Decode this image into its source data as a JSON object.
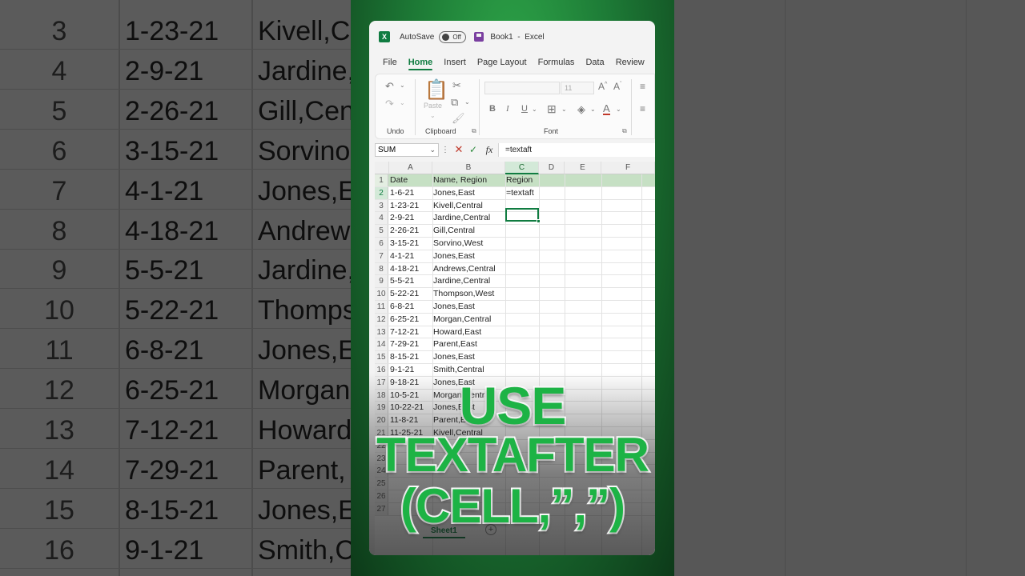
{
  "app": {
    "autosave_label": "AutoSave",
    "autosave_state": "Off",
    "workbook": "Book1",
    "separator": "-",
    "app_name": "Excel",
    "logo_letter": "X",
    "accent_color": "#107c41"
  },
  "tabs": [
    "File",
    "Home",
    "Insert",
    "Page Layout",
    "Formulas",
    "Data",
    "Review"
  ],
  "active_tab": "Home",
  "ribbon": {
    "undo_group": "Undo",
    "clipboard_group": "Clipboard",
    "paste_label": "Paste",
    "font_group": "Font",
    "font_size": "11",
    "bold": "B",
    "italic": "I",
    "underline": "U"
  },
  "formula_bar": {
    "name_box": "SUM",
    "fx_label": "fx",
    "formula": "=textaft"
  },
  "columns": [
    "A",
    "B",
    "C",
    "D",
    "E",
    "F"
  ],
  "rows": [
    {
      "n": "1",
      "a": "Date",
      "b": "Name, Region",
      "c": "Region"
    },
    {
      "n": "2",
      "a": "1-6-21",
      "b": "Jones,East",
      "c": "=textaft"
    },
    {
      "n": "3",
      "a": "1-23-21",
      "b": "Kivell,Central",
      "c": ""
    },
    {
      "n": "4",
      "a": "2-9-21",
      "b": "Jardine,Central",
      "c": ""
    },
    {
      "n": "5",
      "a": "2-26-21",
      "b": "Gill,Central",
      "c": ""
    },
    {
      "n": "6",
      "a": "3-15-21",
      "b": "Sorvino,West",
      "c": ""
    },
    {
      "n": "7",
      "a": "4-1-21",
      "b": "Jones,East",
      "c": ""
    },
    {
      "n": "8",
      "a": "4-18-21",
      "b": "Andrews,Central",
      "c": ""
    },
    {
      "n": "9",
      "a": "5-5-21",
      "b": "Jardine,Central",
      "c": ""
    },
    {
      "n": "10",
      "a": "5-22-21",
      "b": "Thompson,West",
      "c": ""
    },
    {
      "n": "11",
      "a": "6-8-21",
      "b": "Jones,East",
      "c": ""
    },
    {
      "n": "12",
      "a": "6-25-21",
      "b": "Morgan,Central",
      "c": ""
    },
    {
      "n": "13",
      "a": "7-12-21",
      "b": "Howard,East",
      "c": ""
    },
    {
      "n": "14",
      "a": "7-29-21",
      "b": "Parent,East",
      "c": ""
    },
    {
      "n": "15",
      "a": "8-15-21",
      "b": "Jones,East",
      "c": ""
    },
    {
      "n": "16",
      "a": "9-1-21",
      "b": "Smith,Central",
      "c": ""
    },
    {
      "n": "17",
      "a": "9-18-21",
      "b": "Jones,East",
      "c": ""
    },
    {
      "n": "18",
      "a": "10-5-21",
      "b": "Morgan,Central",
      "c": ""
    },
    {
      "n": "19",
      "a": "10-22-21",
      "b": "Jones,East",
      "c": ""
    },
    {
      "n": "20",
      "a": "11-8-21",
      "b": "Parent,East",
      "c": ""
    },
    {
      "n": "21",
      "a": "11-25-21",
      "b": "Kivell,Central",
      "c": ""
    },
    {
      "n": "22",
      "a": "",
      "b": "",
      "c": ""
    },
    {
      "n": "23",
      "a": "",
      "b": "",
      "c": ""
    },
    {
      "n": "24",
      "a": "",
      "b": "",
      "c": ""
    },
    {
      "n": "25",
      "a": "",
      "b": "",
      "c": ""
    },
    {
      "n": "26",
      "a": "",
      "b": "",
      "c": ""
    },
    {
      "n": "27",
      "a": "",
      "b": "",
      "c": ""
    }
  ],
  "sheet_tab": "Sheet1",
  "caption": {
    "line1": "USE",
    "line2": "TEXTAFTER",
    "line3": "(CELL,”,”)",
    "color": "#1db345"
  },
  "background_rows": [
    {
      "n": "3",
      "d": "1-23-21",
      "r": "Kivell,C"
    },
    {
      "n": "4",
      "d": "2-9-21",
      "r": "Jardine,"
    },
    {
      "n": "5",
      "d": "2-26-21",
      "r": "Gill,Cen"
    },
    {
      "n": "6",
      "d": "3-15-21",
      "r": "Sorvino"
    },
    {
      "n": "7",
      "d": "4-1-21",
      "r": "Jones,E"
    },
    {
      "n": "8",
      "d": "4-18-21",
      "r": "Andrew"
    },
    {
      "n": "9",
      "d": "5-5-21",
      "r": "Jardine,"
    },
    {
      "n": "10",
      "d": "5-22-21",
      "r": "Thomps"
    },
    {
      "n": "11",
      "d": "6-8-21",
      "r": "Jones,E"
    },
    {
      "n": "12",
      "d": "6-25-21",
      "r": "Morgan"
    },
    {
      "n": "13",
      "d": "7-12-21",
      "r": "Howard"
    },
    {
      "n": "14",
      "d": "7-29-21",
      "r": "Parent,"
    },
    {
      "n": "15",
      "d": "8-15-21",
      "r": "Jones,E"
    },
    {
      "n": "16",
      "d": "9-1-21",
      "r": "Smith,C"
    }
  ]
}
